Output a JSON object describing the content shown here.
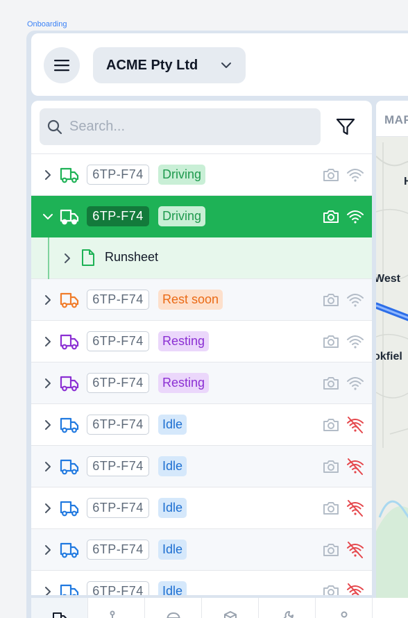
{
  "frame": {
    "label": "Onboarding"
  },
  "header": {
    "org_name": "ACME Pty Ltd"
  },
  "search": {
    "placeholder": "Search..."
  },
  "map": {
    "tab_label": "MAP",
    "labels": [
      "H",
      "West",
      "okfiel"
    ]
  },
  "colors": {
    "green": "#1eb256",
    "orange": "#f07c2a",
    "purple": "#8b2fd3",
    "blue": "#2079e0",
    "gray_icon": "#b3bcc7",
    "red_wifi": "#e5484d"
  },
  "vehicles": [
    {
      "plate": "6TP-F74",
      "status": "Driving",
      "status_key": "driving",
      "truck_color": "green",
      "wifi": "ok",
      "expanded": false
    },
    {
      "plate": "6TP-F74",
      "status": "Driving",
      "status_key": "driving",
      "truck_color": "white",
      "wifi": "ok",
      "expanded": true,
      "selected": true,
      "children": [
        {
          "label": "Runsheet",
          "icon": "document-icon"
        }
      ]
    },
    {
      "plate": "6TP-F74",
      "status": "Rest soon",
      "status_key": "restsoon",
      "truck_color": "orange",
      "wifi": "ok"
    },
    {
      "plate": "6TP-F74",
      "status": "Resting",
      "status_key": "resting",
      "truck_color": "purple",
      "wifi": "ok"
    },
    {
      "plate": "6TP-F74",
      "status": "Resting",
      "status_key": "resting",
      "truck_color": "purple",
      "wifi": "ok"
    },
    {
      "plate": "6TP-F74",
      "status": "Idle",
      "status_key": "idle",
      "truck_color": "blue",
      "wifi": "off"
    },
    {
      "plate": "6TP-F74",
      "status": "Idle",
      "status_key": "idle",
      "truck_color": "blue",
      "wifi": "off"
    },
    {
      "plate": "6TP-F74",
      "status": "Idle",
      "status_key": "idle",
      "truck_color": "blue",
      "wifi": "off"
    },
    {
      "plate": "6TP-F74",
      "status": "Idle",
      "status_key": "idle",
      "truck_color": "blue",
      "wifi": "off"
    },
    {
      "plate": "6TP-F74",
      "status": "Idle",
      "status_key": "idle",
      "truck_color": "blue",
      "wifi": "off"
    }
  ],
  "bottom_nav": [
    {
      "icon": "truck-icon",
      "active": true
    },
    {
      "icon": "route-icon"
    },
    {
      "icon": "helmet-icon"
    },
    {
      "icon": "package-icon"
    },
    {
      "icon": "wrench-icon"
    },
    {
      "icon": "user-icon"
    }
  ]
}
